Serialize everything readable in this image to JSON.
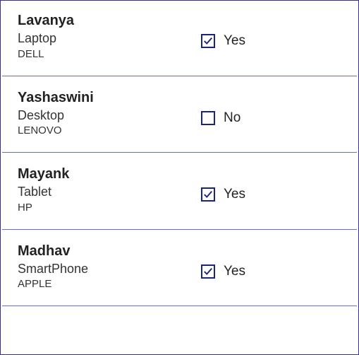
{
  "labels": {
    "yes": "Yes",
    "no": "No"
  },
  "items": [
    {
      "name": "Lavanya",
      "device": "Laptop",
      "brand": "DELL",
      "checked": true
    },
    {
      "name": "Yashaswini",
      "device": "Desktop",
      "brand": "LENOVO",
      "checked": false
    },
    {
      "name": "Mayank",
      "device": "Tablet",
      "brand": "HP",
      "checked": true
    },
    {
      "name": "Madhav",
      "device": "SmartPhone",
      "brand": "APPLE",
      "checked": true
    }
  ]
}
